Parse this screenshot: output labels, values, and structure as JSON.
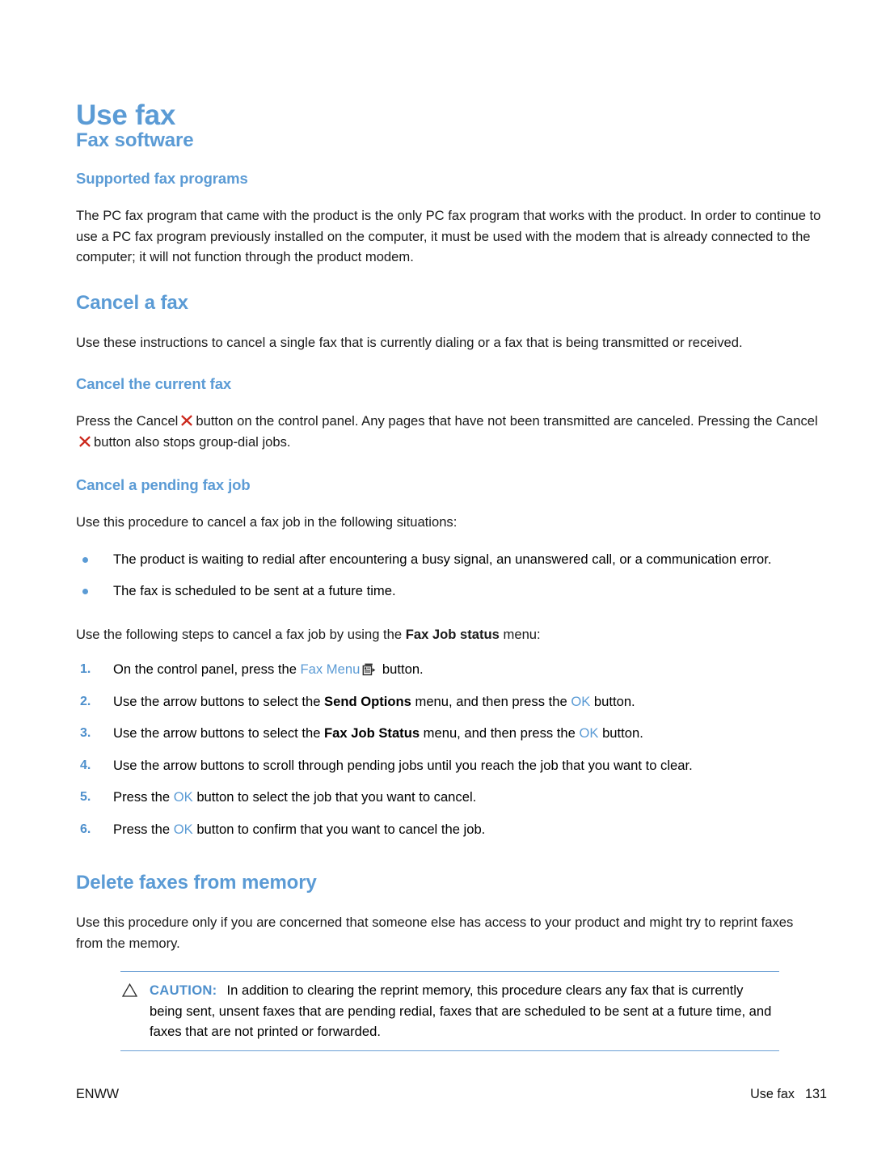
{
  "page": {
    "title": "Use fax",
    "accent_color": "#5b9bd5",
    "cancel_icon_color": "#cc2a1e"
  },
  "sections": {
    "fax_software": {
      "heading": "Fax software",
      "subheading": "Supported fax programs",
      "paragraph": "The PC fax program that came with the product is the only PC fax program that works with the product. In order to continue to use a PC fax program previously installed on the computer, it must be used with the modem that is already connected to the computer; it will not function through the product modem."
    },
    "cancel_a_fax": {
      "heading": "Cancel a fax",
      "paragraph": "Use these instructions to cancel a single fax that is currently dialing or a fax that is being transmitted or received.",
      "current_fax": {
        "subheading": "Cancel the current fax",
        "line1_pre": "Press the Cancel",
        "line1_post": "button on the control panel. Any pages that have not been transmitted are canceled. Pressing the Cancel",
        "line1_end": "button also stops group-dial jobs.",
        "cancel_icon_name": "cancel-x-icon"
      },
      "pending_fax_job": {
        "subheading": "Cancel a pending fax job",
        "intro": "Use this procedure to cancel a fax job in the following situations:",
        "bullets": [
          "The product is waiting to redial after encountering a busy signal, an unanswered call, or a communication error.",
          "The fax is scheduled to be sent at a future time."
        ],
        "steps_intro_pre": "Use the following steps to cancel a fax job by using the ",
        "steps_intro_bold": "Fax Job status",
        "steps_intro_post": " menu:",
        "steps": [
          {
            "num": "1.",
            "pre": "On the control panel, press the ",
            "blue": "Fax Menu",
            "icon": "fax-menu-icon",
            "post": " button."
          },
          {
            "num": "2.",
            "pre": "Use the arrow buttons to select the ",
            "bold": "Send Options",
            "mid": " menu, and then press the ",
            "blue": "OK",
            "post": " button."
          },
          {
            "num": "3.",
            "pre": "Use the arrow buttons to select the ",
            "bold": "Fax Job Status",
            "mid": " menu, and then press the ",
            "blue": "OK",
            "post": " button."
          },
          {
            "num": "4.",
            "pre": "Use the arrow buttons to scroll through pending jobs until you reach the job that you want to clear."
          },
          {
            "num": "5.",
            "pre": "Press the ",
            "blue": "OK",
            "post": " button to select the job that you want to cancel."
          },
          {
            "num": "6.",
            "pre": "Press the ",
            "blue": "OK",
            "post": " button to confirm that you want to cancel the job."
          }
        ]
      }
    },
    "delete_faxes": {
      "heading": "Delete faxes from memory",
      "paragraph": "Use this procedure only if you are concerned that someone else has access to your product and might try to reprint faxes from the memory.",
      "caution": {
        "icon": "warning-triangle-icon",
        "label": "CAUTION:",
        "text": "In addition to clearing the reprint memory, this procedure clears any fax that is currently being sent, unsent faxes that are pending redial, faxes that are scheduled to be sent at a future time, and faxes that are not printed or forwarded."
      }
    }
  },
  "footer": {
    "left": "ENWW",
    "right_label": "Use fax",
    "page_number": "131"
  }
}
